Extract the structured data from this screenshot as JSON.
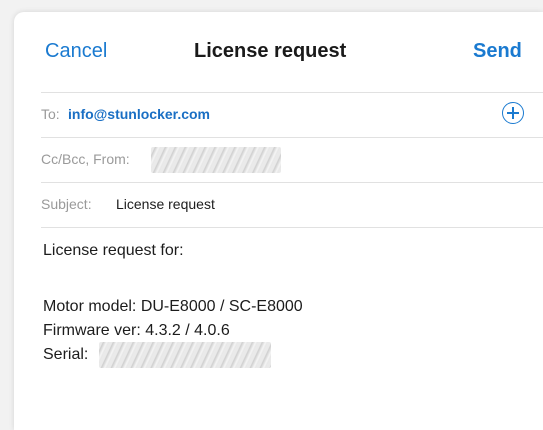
{
  "navbar": {
    "cancel_label": "Cancel",
    "title": "License request",
    "send_label": "Send"
  },
  "to": {
    "label": "To:",
    "value": "info@stunlocker.com"
  },
  "ccbcc": {
    "label": "Cc/Bcc, From:"
  },
  "subject": {
    "label": "Subject:",
    "value": "License request"
  },
  "body": {
    "line1": "License request for:",
    "line2": "Motor model: DU-E8000 / SC-E8000",
    "line3": "Firmware ver: 4.3.2 / 4.0.6",
    "line4": "Serial:"
  },
  "colors": {
    "accent": "#1a7ad0",
    "text": "#1d1d1d",
    "label": "#9a9a9a"
  },
  "icons": {
    "add": "plus-circle-icon"
  }
}
